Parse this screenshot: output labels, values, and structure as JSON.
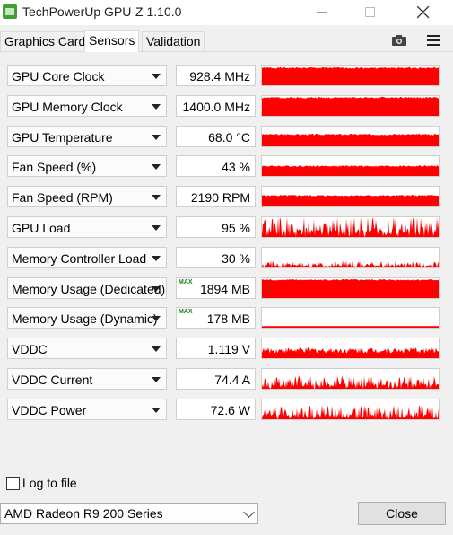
{
  "window": {
    "title": "TechPowerUp GPU-Z 1.10.0",
    "controls": [
      "minimize",
      "maximize",
      "close"
    ]
  },
  "tabs": [
    {
      "label": "Graphics Card",
      "active": false
    },
    {
      "label": "Sensors",
      "active": true
    },
    {
      "label": "Validation",
      "active": false
    }
  ],
  "toolbar_icons": [
    "camera-icon",
    "hamburger-menu-icon"
  ],
  "sensors": [
    {
      "name": "GPU Core Clock",
      "value": "928.4 MHz",
      "max": false,
      "graph_level": 0.88,
      "graph_style": "solid",
      "seed": 1
    },
    {
      "name": "GPU Memory Clock",
      "value": "1400.0 MHz",
      "max": false,
      "graph_level": 0.92,
      "graph_style": "solid",
      "seed": 2
    },
    {
      "name": "GPU Temperature",
      "value": "68.0 °C",
      "max": false,
      "graph_level": 0.6,
      "graph_style": "solid",
      "seed": 3
    },
    {
      "name": "Fan Speed (%)",
      "value": "43 %",
      "max": false,
      "graph_level": 0.5,
      "graph_style": "solid",
      "seed": 4
    },
    {
      "name": "Fan Speed (RPM)",
      "value": "2190 RPM",
      "max": false,
      "graph_level": 0.55,
      "graph_style": "solid",
      "seed": 5
    },
    {
      "name": "GPU Load",
      "value": "95 %",
      "max": false,
      "graph_level": 0.9,
      "graph_style": "spiky",
      "seed": 6
    },
    {
      "name": "Memory Controller Load",
      "value": "30 %",
      "max": false,
      "graph_level": 0.3,
      "graph_style": "spiky",
      "seed": 7
    },
    {
      "name": "Memory Usage (Dedicated)",
      "value": "1894 MB",
      "max": true,
      "graph_level": 0.92,
      "graph_style": "solid",
      "seed": 8
    },
    {
      "name": "Memory Usage (Dynamic)",
      "value": "178 MB",
      "max": true,
      "graph_level": 0.08,
      "graph_style": "thin",
      "seed": 9
    },
    {
      "name": "VDDC",
      "value": "1.119 V",
      "max": false,
      "graph_level": 0.4,
      "graph_style": "noisy",
      "seed": 10
    },
    {
      "name": "VDDC Current",
      "value": "74.4 A",
      "max": false,
      "graph_level": 0.55,
      "graph_style": "spiky",
      "seed": 11
    },
    {
      "name": "VDDC Power",
      "value": "72.6 W",
      "max": false,
      "graph_level": 0.6,
      "graph_style": "spiky",
      "seed": 12
    }
  ],
  "max_label": "MAX",
  "graph_color": "#ff0000",
  "log_to_file": {
    "label": "Log to file",
    "checked": false
  },
  "gpu_select": {
    "selected": "AMD Radeon R9 200 Series"
  },
  "close_button": {
    "label": "Close"
  }
}
